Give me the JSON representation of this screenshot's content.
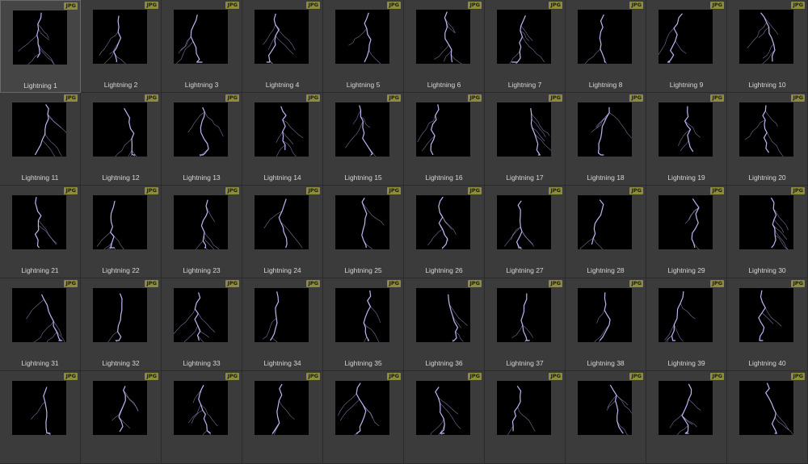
{
  "app": {
    "badge_label": "JPG",
    "colors": {
      "background": "#3b3b3b",
      "badge": "#8c8c3a",
      "thumb_bg": "#000000",
      "bolt": "#c8c0ff",
      "label": "#d6d6d6"
    },
    "icon": "lightning-bolt-icon"
  },
  "items": [
    {
      "label": "Lightning 1",
      "file_type": "JPG",
      "selected": true
    },
    {
      "label": "Lightning 2",
      "file_type": "JPG"
    },
    {
      "label": "Lightning 3",
      "file_type": "JPG"
    },
    {
      "label": "Lightning 4",
      "file_type": "JPG"
    },
    {
      "label": "Lightning 5",
      "file_type": "JPG"
    },
    {
      "label": "Lightning 6",
      "file_type": "JPG"
    },
    {
      "label": "Lightning 7",
      "file_type": "JPG"
    },
    {
      "label": "Lightning 8",
      "file_type": "JPG"
    },
    {
      "label": "Lightning 9",
      "file_type": "JPG"
    },
    {
      "label": "Lightning 10",
      "file_type": "JPG"
    },
    {
      "label": "Lightning 11",
      "file_type": "JPG"
    },
    {
      "label": "Lightning 12",
      "file_type": "JPG"
    },
    {
      "label": "Lightning 13",
      "file_type": "JPG"
    },
    {
      "label": "Lightning 14",
      "file_type": "JPG"
    },
    {
      "label": "Lightning 15",
      "file_type": "JPG"
    },
    {
      "label": "Lightning 16",
      "file_type": "JPG"
    },
    {
      "label": "Lightning 17",
      "file_type": "JPG"
    },
    {
      "label": "Lightning 18",
      "file_type": "JPG"
    },
    {
      "label": "Lightning 19",
      "file_type": "JPG"
    },
    {
      "label": "Lightning 20",
      "file_type": "JPG"
    },
    {
      "label": "Lightning 21",
      "file_type": "JPG"
    },
    {
      "label": "Lightning 22",
      "file_type": "JPG"
    },
    {
      "label": "Lightning 23",
      "file_type": "JPG"
    },
    {
      "label": "Lightning 24",
      "file_type": "JPG"
    },
    {
      "label": "Lightning 25",
      "file_type": "JPG"
    },
    {
      "label": "Lightning 26",
      "file_type": "JPG"
    },
    {
      "label": "Lightning 27",
      "file_type": "JPG"
    },
    {
      "label": "Lightning 28",
      "file_type": "JPG"
    },
    {
      "label": "Lightning 29",
      "file_type": "JPG"
    },
    {
      "label": "Lightning 30",
      "file_type": "JPG"
    },
    {
      "label": "Lightning 31",
      "file_type": "JPG"
    },
    {
      "label": "Lightning 32",
      "file_type": "JPG"
    },
    {
      "label": "Lightning 33",
      "file_type": "JPG"
    },
    {
      "label": "Lightning 34",
      "file_type": "JPG"
    },
    {
      "label": "Lightning 35",
      "file_type": "JPG"
    },
    {
      "label": "Lightning 36",
      "file_type": "JPG"
    },
    {
      "label": "Lightning 37",
      "file_type": "JPG"
    },
    {
      "label": "Lightning 38",
      "file_type": "JPG"
    },
    {
      "label": "Lightning 39",
      "file_type": "JPG"
    },
    {
      "label": "Lightning 40",
      "file_type": "JPG"
    },
    {
      "label": "",
      "file_type": "JPG"
    },
    {
      "label": "",
      "file_type": "JPG"
    },
    {
      "label": "",
      "file_type": "JPG"
    },
    {
      "label": "",
      "file_type": "JPG"
    },
    {
      "label": "",
      "file_type": "JPG"
    },
    {
      "label": "",
      "file_type": "JPG"
    },
    {
      "label": "",
      "file_type": "JPG"
    },
    {
      "label": "",
      "file_type": "JPG"
    },
    {
      "label": "",
      "file_type": "JPG"
    },
    {
      "label": "",
      "file_type": "JPG"
    }
  ]
}
